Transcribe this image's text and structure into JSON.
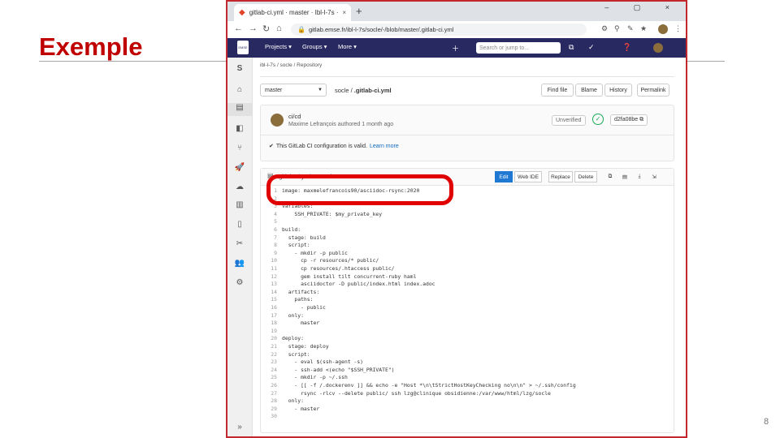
{
  "slide": {
    "title": "Exemple",
    "page_number": "8"
  },
  "browser": {
    "tab_title": "gitlab-ci.yml · master · Ibl-l-7s ·",
    "tab_close": "×",
    "new_tab": "+",
    "window_buttons": "– ▢ ×",
    "nav": {
      "back": "←",
      "forward": "→",
      "reload": "↻",
      "home": "⌂"
    },
    "url": "gitlab.emse.fr/ibl-l-7s/socle/-/blob/master/.gitlab-ci.yml",
    "lock": "🔒",
    "extensions": [
      "⚙",
      "⚲",
      "✎",
      "★",
      "⋮"
    ]
  },
  "gitlab": {
    "logo": "EMSE",
    "menu": [
      "Projects ▾",
      "Groups ▾",
      "More ▾"
    ],
    "search_placeholder": "Search or jump to...",
    "icons": [
      "＋",
      "⧉",
      "✓",
      "❓"
    ],
    "sidebar": [
      "S",
      "⌂",
      "▤",
      "◧",
      "⑂",
      "🚀",
      "☁",
      "▥",
      "▯",
      "✂",
      "👥",
      "⚙",
      "»"
    ]
  },
  "breadcrumb": "ibl-l-7s  /  socle  /  Repository",
  "repo": {
    "branch": "master",
    "path_prefix": "socle / ",
    "file": ".gitlab-ci.yml",
    "buttons": [
      "Find file",
      "Blame",
      "History",
      "Permalink"
    ]
  },
  "commit": {
    "title": "ci/cd",
    "meta": "Maxime Lefrançois authored 1 month ago",
    "unverified": "Unverified",
    "sha": "d2fa08be ⧉",
    "ci_message": "This GitLab CI configuration is valid.",
    "learn_more": "Learn more"
  },
  "file_view": {
    "name": ".gitlab-ci.yml  1.05 KiB",
    "buttons": [
      "Edit",
      "Web IDE",
      "Replace",
      "Delete"
    ],
    "tools": [
      "⧉",
      "▤",
      "⤓",
      "⇲"
    ]
  },
  "code": [
    {
      "n": "1",
      "t": "image: maxmelefrancois90/asciidoc-rsync:2020"
    },
    {
      "n": "2",
      "t": ""
    },
    {
      "n": "3",
      "t": "variables:"
    },
    {
      "n": "4",
      "t": "    SSH_PRIVATE: $my_private_key"
    },
    {
      "n": "5",
      "t": ""
    },
    {
      "n": "6",
      "t": "build:"
    },
    {
      "n": "7",
      "t": "  stage: build"
    },
    {
      "n": "8",
      "t": "  script:"
    },
    {
      "n": "9",
      "t": "    - mkdir -p public"
    },
    {
      "n": "10",
      "t": "      cp -r resources/* public/"
    },
    {
      "n": "11",
      "t": "      cp resources/.htaccess public/"
    },
    {
      "n": "12",
      "t": "      gem install tilt concurrent-ruby haml"
    },
    {
      "n": "13",
      "t": "      asciidoctor -D public/index.html index.adoc"
    },
    {
      "n": "14",
      "t": "  artifacts:"
    },
    {
      "n": "15",
      "t": "    paths:"
    },
    {
      "n": "16",
      "t": "      - public"
    },
    {
      "n": "17",
      "t": "  only:"
    },
    {
      "n": "18",
      "t": "      master"
    },
    {
      "n": "19",
      "t": ""
    },
    {
      "n": "20",
      "t": "deploy:"
    },
    {
      "n": "21",
      "t": "  stage: deploy"
    },
    {
      "n": "22",
      "t": "  script:"
    },
    {
      "n": "23",
      "t": "    - eval $(ssh-agent -s)"
    },
    {
      "n": "24",
      "t": "    - ssh-add <(echo \"$SSH_PRIVATE\")"
    },
    {
      "n": "25",
      "t": "    - mkdir -p ~/.ssh"
    },
    {
      "n": "26",
      "t": "    - [[ -f /.dockerenv ]] && echo -e \"Host *\\n\\tStrictHostKeyChecking no\\n\\n\" > ~/.ssh/config"
    },
    {
      "n": "27",
      "t": "      rsync -rlcv --delete public/ ssh lzg@clinique obsidienne:/var/www/html/lzg/socle"
    },
    {
      "n": "28",
      "t": "  only:"
    },
    {
      "n": "29",
      "t": "    - master"
    },
    {
      "n": "30",
      "t": ""
    }
  ]
}
